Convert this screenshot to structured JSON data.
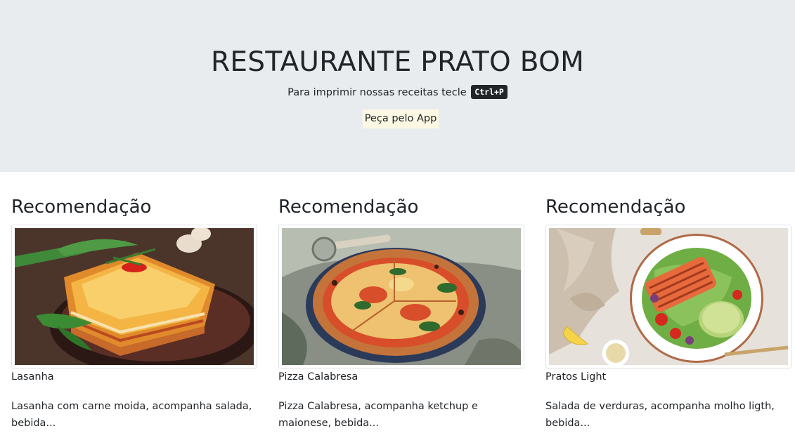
{
  "header": {
    "title": "RESTAURANTE PRATO BOM",
    "print_hint": "Para imprimir nossas receitas tecle",
    "shortcut": "Ctrl+P",
    "app_button": "Peça pelo App"
  },
  "cards": [
    {
      "heading": "Recomendação",
      "name": "Lasanha",
      "description": "Lasanha com carne moida, acompanha salada, bebida...",
      "image_alt": "lasagna-photo"
    },
    {
      "heading": "Recomendação",
      "name": "Pizza Calabresa",
      "description": "Pizza Calabresa, acompanha ketchup e maionese, bebida...",
      "image_alt": "pizza-photo"
    },
    {
      "heading": "Recomendação",
      "name": "Pratos Light",
      "description": "Salada de verduras, acompanha molho ligth, bebida...",
      "image_alt": "salad-photo"
    }
  ]
}
